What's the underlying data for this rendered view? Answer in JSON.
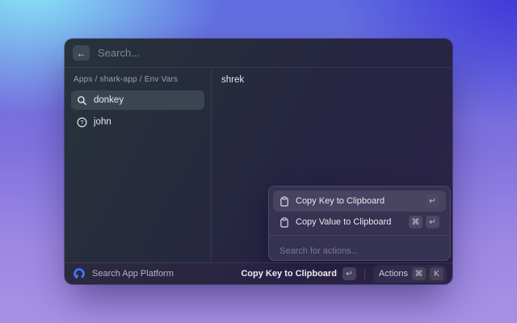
{
  "colors": {
    "accent_blue": "#3f76f5",
    "selected_row": "#3b4551",
    "popup_selected": "#474360",
    "bg_top_left": "#8ceaf8",
    "bg_top_right": "#3b2fd8",
    "bg_bottom": "#a791e7"
  },
  "header": {
    "back_icon": "←",
    "search_placeholder": "Search..."
  },
  "sidebar": {
    "breadcrumb": "Apps / shark-app / Env Vars",
    "items": [
      {
        "icon": "magnifier-icon",
        "label": "donkey",
        "selected": true
      },
      {
        "icon": "question-icon",
        "label": "john",
        "selected": false
      }
    ]
  },
  "detail": {
    "value": "shrek"
  },
  "actions_popup": {
    "items": [
      {
        "icon": "clipboard-icon",
        "label": "Copy Key to Clipboard",
        "keys": [
          "↵"
        ],
        "selected": true
      },
      {
        "icon": "clipboard-icon",
        "label": "Copy Value to Clipboard",
        "keys": [
          "⌘",
          "↵"
        ],
        "selected": false
      }
    ],
    "search_placeholder": "Search for actions..."
  },
  "statusbar": {
    "app_name": "Search App Platform",
    "primary_action": {
      "label": "Copy Key to Clipboard",
      "keys": [
        "↵"
      ]
    },
    "actions_button": {
      "label": "Actions",
      "keys": [
        "⌘",
        "K"
      ]
    }
  }
}
